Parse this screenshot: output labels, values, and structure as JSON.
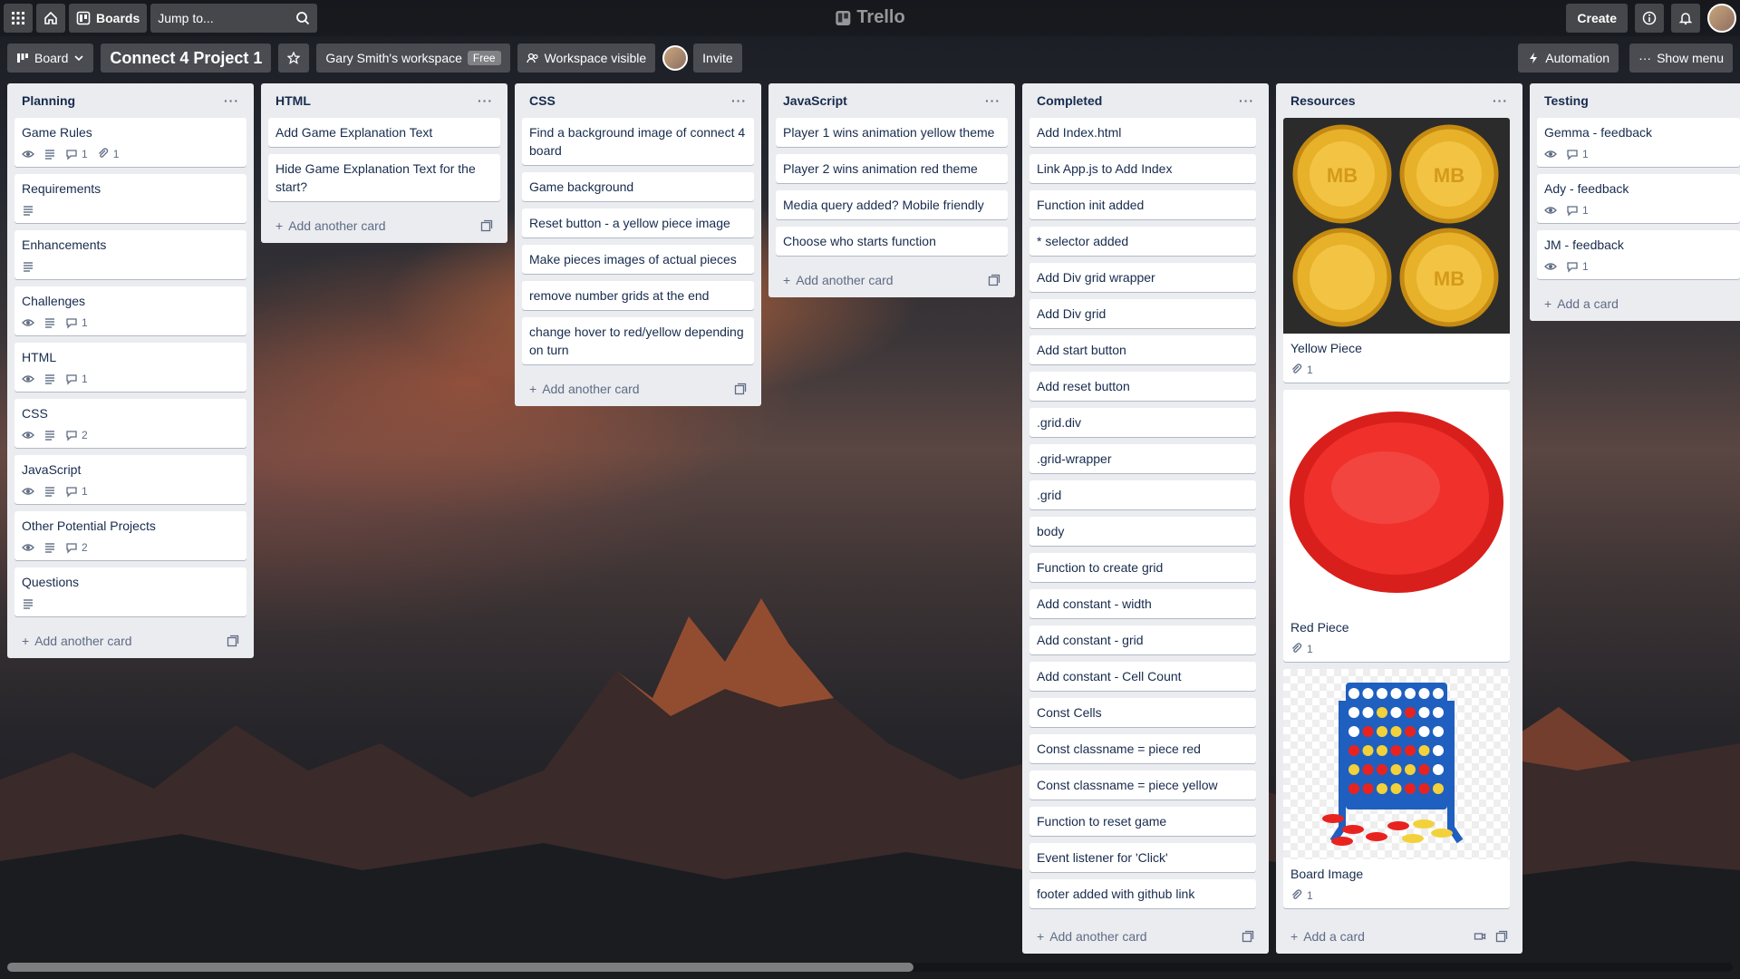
{
  "topbar": {
    "boards_label": "Boards",
    "search_placeholder": "Jump to...",
    "logo_text": "Trello",
    "create_label": "Create"
  },
  "boardbar": {
    "view_label": "Board",
    "title": "Connect 4 Project 1",
    "workspace": "Gary Smith's workspace",
    "workspace_badge": "Free",
    "visibility": "Workspace visible",
    "invite": "Invite",
    "automation": "Automation",
    "show_menu": "Show menu"
  },
  "lists": {
    "planning": {
      "title": "Planning",
      "cards": [
        {
          "title": "Game Rules",
          "comments": "1",
          "attachments": "1"
        },
        {
          "title": "Requirements"
        },
        {
          "title": "Enhancements"
        },
        {
          "title": "Challenges",
          "comments": "1"
        },
        {
          "title": "HTML",
          "comments": "1"
        },
        {
          "title": "CSS",
          "comments": "2"
        },
        {
          "title": "JavaScript",
          "comments": "1"
        },
        {
          "title": "Other Potential Projects",
          "comments": "2"
        },
        {
          "title": "Questions"
        }
      ],
      "add_label": "Add another card"
    },
    "html": {
      "title": "HTML",
      "cards": [
        "Add Game Explanation Text",
        "Hide Game Explanation Text for the start?"
      ],
      "add_label": "Add another card"
    },
    "css": {
      "title": "CSS",
      "cards": [
        "Find a background image of connect 4 board",
        "Game background",
        "Reset button - a yellow piece image",
        "Make pieces images of actual pieces",
        "remove number grids at the end",
        "change hover to red/yellow depending on turn"
      ],
      "add_label": "Add another card"
    },
    "javascript": {
      "title": "JavaScript",
      "cards": [
        "Player 1 wins animation yellow theme",
        "Player 2 wins animation red theme",
        "Media query added? Mobile friendly",
        "Choose who starts function"
      ],
      "add_label": "Add another card"
    },
    "completed": {
      "title": "Completed",
      "cards": [
        "Add Index.html",
        "Link App.js to Add Index",
        "Function init added",
        "* selector added",
        "Add Div grid wrapper",
        "Add Div grid",
        "Add start button",
        "Add reset button",
        ".grid.div",
        ".grid-wrapper",
        ".grid",
        "body",
        "Function to create grid",
        "Add constant - width",
        "Add constant - grid",
        "Add constant - Cell Count",
        "Const Cells",
        "Const classname = piece red",
        "Const classname = piece yellow",
        "Function to reset game",
        "Event listener for 'Click'",
        "footer added with github link"
      ],
      "add_label": "Add another card"
    },
    "resources": {
      "title": "Resources",
      "cards": [
        {
          "title": "Yellow Piece",
          "attachments": "1"
        },
        {
          "title": "Red Piece",
          "attachments": "1"
        },
        {
          "title": "Board Image",
          "attachments": "1"
        }
      ],
      "add_label": "Add a card"
    },
    "testing": {
      "title": "Testing",
      "cards": [
        {
          "title": "Gemma - feedback",
          "comments": "1"
        },
        {
          "title": "Ady - feedback",
          "comments": "1"
        },
        {
          "title": "JM - feedback",
          "comments": "1"
        }
      ],
      "add_label": "Add a card"
    }
  },
  "list_menu_glyph": "···",
  "plus_glyph": "+",
  "yellow_piece_text": "MB",
  "colors": {
    "list_bg": "#ebecf0",
    "card_bg": "#ffffff",
    "text": "#172b4d",
    "muted": "#5e6c84",
    "red_piece": "#e8231f",
    "yellow_piece": "#f0b429",
    "board_blue": "#1f5fbf"
  }
}
